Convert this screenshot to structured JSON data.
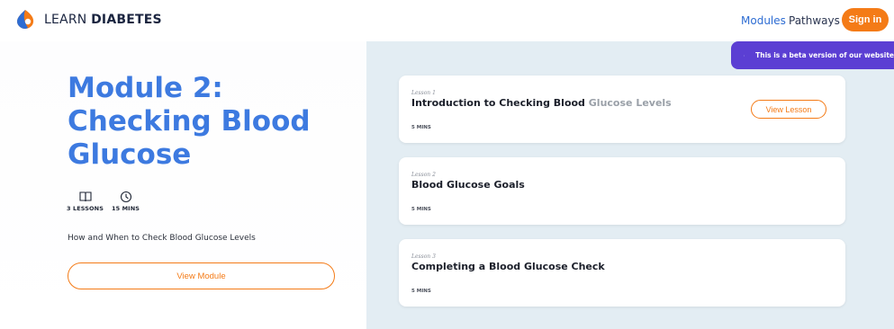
{
  "header": {
    "brand_light": "LEARN",
    "brand_bold": "DIABETES",
    "nav": [
      {
        "label": "Modules"
      },
      {
        "label": "Pathways"
      }
    ],
    "signin_label": "Sign in"
  },
  "beta_banner": {
    "text": "This is a beta version of our website"
  },
  "module": {
    "title": "Module 2: Checking Blood Glucose",
    "lessons_count": "3 LESSONS",
    "duration": "15 MINS",
    "description": "How and When to Check Blood Glucose Levels",
    "view_label": "View Module"
  },
  "lessons": [
    {
      "number": "Lesson 1",
      "title_main": "Introduction to Checking Blood",
      "title_faded": " Glucose Levels",
      "duration": "5 MINS",
      "action": "View Lesson"
    },
    {
      "number": "Lesson 2",
      "title_main": "Blood Glucose Goals",
      "duration": "5 MINS"
    },
    {
      "number": "Lesson 3",
      "title_main": "Completing a Blood Glucose Check",
      "duration": "5 MINS"
    }
  ],
  "colors": {
    "accent_orange": "#f47b17",
    "title_blue": "#3d7ae0",
    "banner_purple": "#5b3fd3",
    "panel_bg": "#e3edf3"
  },
  "icons": {
    "logo": "learn-diabetes-logo",
    "lessons": "book-icon",
    "duration": "clock-icon",
    "beta": "megaphone-icon"
  }
}
